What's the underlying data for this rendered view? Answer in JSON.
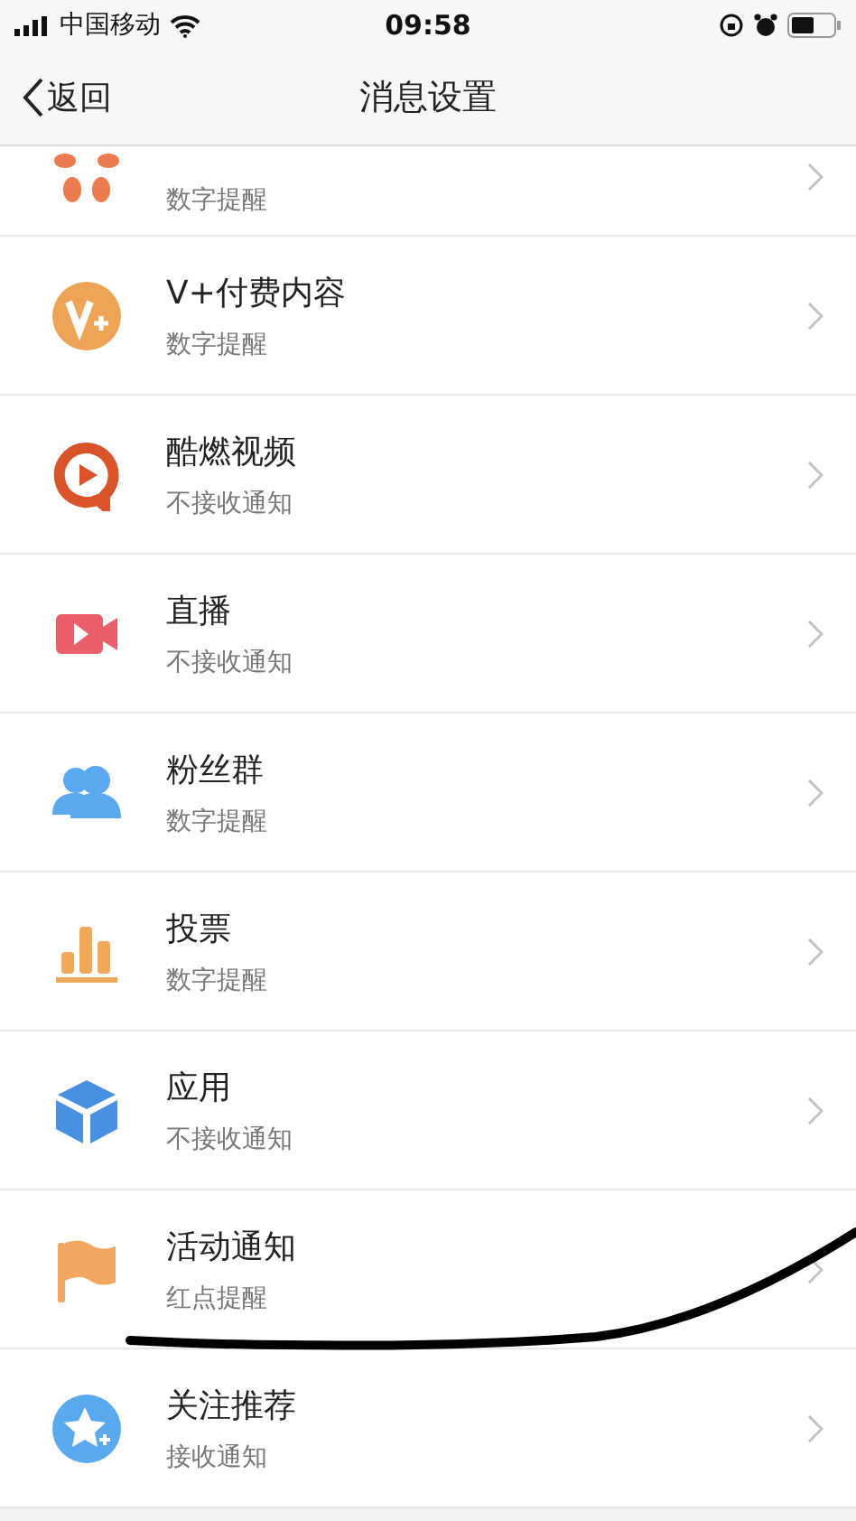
{
  "status_bar": {
    "carrier": "中国移动",
    "time": "09:58"
  },
  "nav": {
    "back": "返回",
    "title": "消息设置"
  },
  "partial_row": {
    "subtitle": "数字提醒"
  },
  "rows": [
    {
      "title": "V+付费内容",
      "subtitle": "数字提醒"
    },
    {
      "title": "酷燃视频",
      "subtitle": "不接收通知"
    },
    {
      "title": "直播",
      "subtitle": "不接收通知"
    },
    {
      "title": "粉丝群",
      "subtitle": "数字提醒"
    },
    {
      "title": "投票",
      "subtitle": "数字提醒"
    },
    {
      "title": "应用",
      "subtitle": "不接收通知"
    },
    {
      "title": "活动通知",
      "subtitle": "红点提醒"
    },
    {
      "title": "关注推荐",
      "subtitle": "接收通知"
    }
  ]
}
